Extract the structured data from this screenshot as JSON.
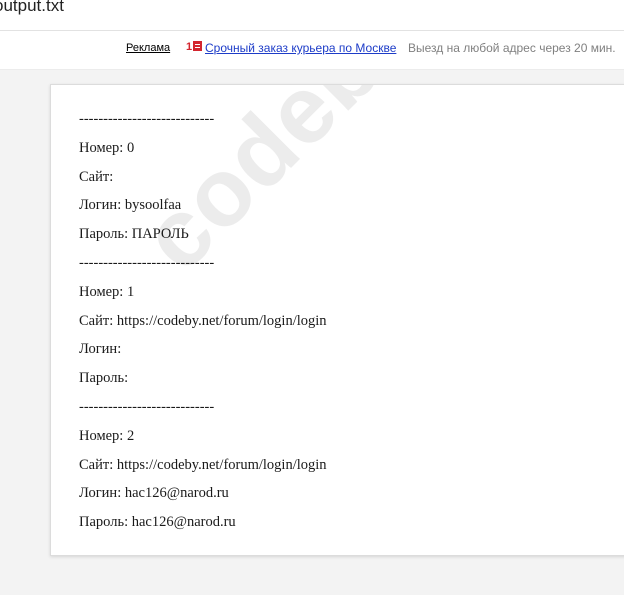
{
  "header": {
    "file_title": "output.txt"
  },
  "ad": {
    "label": "Реклама",
    "icon_number": "1",
    "icon_name": "yandex-delivery-icon",
    "link_text": "Срочный заказ курьера по Москве",
    "description": "Выезд на любой адрес через 20 мин."
  },
  "watermark": {
    "text": "codeby.net"
  },
  "document": {
    "lines": [
      "----------------------------",
      "Номер: 0",
      "Сайт:",
      "Логин: bysoolfaa",
      "Пароль: ПАРОЛЬ",
      "----------------------------",
      "Номер: 1",
      "Сайт: https://codeby.net/forum/login/login",
      "Логин:",
      "Пароль:",
      "----------------------------",
      "Номер: 2",
      "Сайт: https://codeby.net/forum/login/login",
      "Логин: hac126@narod.ru",
      "Пароль: hac126@narod.ru"
    ]
  },
  "colors": {
    "background": "#f3f3f3",
    "ad_link": "#1d3cc8",
    "ad_description": "#808080",
    "ad_icon": "#d3262f"
  }
}
